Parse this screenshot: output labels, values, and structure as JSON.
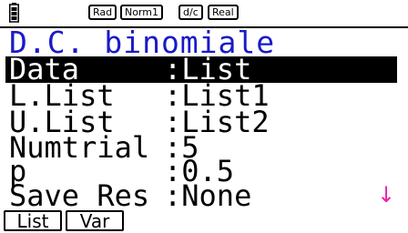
{
  "status": {
    "angle": "Rad",
    "display": "Norm1",
    "fraction": "d/c",
    "complex": "Real"
  },
  "title": "D.C. binomiale",
  "settings": [
    {
      "label": "Data",
      "value": "List"
    },
    {
      "label": "L.List",
      "value": "List1"
    },
    {
      "label": "U.List",
      "value": "List2"
    },
    {
      "label": "Numtrial",
      "value": "5"
    },
    {
      "label": "p",
      "value": "0.5"
    },
    {
      "label": "Save Res",
      "value": "None"
    }
  ],
  "separator": ":",
  "scroll_indicator": "↓",
  "function_keys": [
    "List",
    "Var"
  ],
  "colors": {
    "title": "#1a1ac8",
    "scroll_arrow": "#ee22aa",
    "selection": "#000000"
  }
}
